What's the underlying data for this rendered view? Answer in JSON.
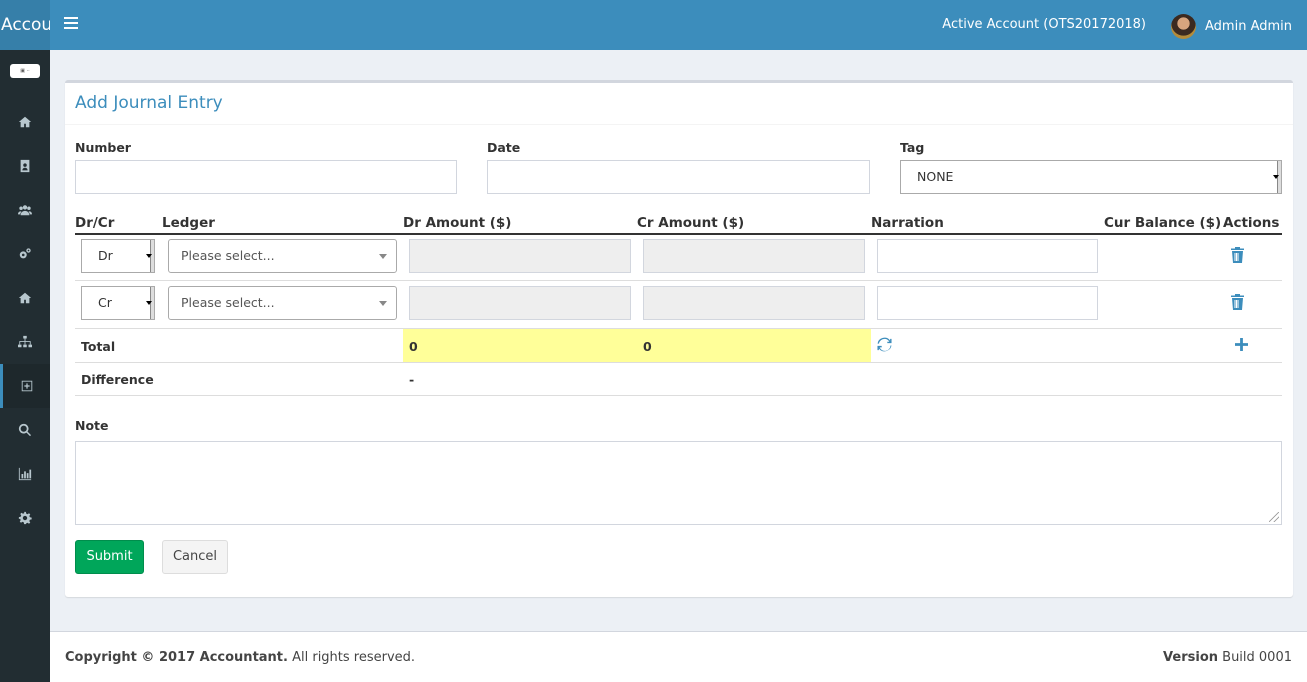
{
  "header": {
    "brand": "Accou",
    "active_account": "Active Account (OTS20172018)",
    "user_name": "Admin Admin"
  },
  "sidebar": {
    "logo_text": "logo",
    "items": [
      {
        "icon": "home-icon"
      },
      {
        "icon": "address-book-icon"
      },
      {
        "icon": "users-icon"
      },
      {
        "icon": "cogs-icon"
      },
      {
        "icon": "home-icon"
      },
      {
        "icon": "sitemap-icon"
      },
      {
        "icon": "plus-square-icon",
        "active": true
      },
      {
        "icon": "search-icon"
      },
      {
        "icon": "bar-chart-icon"
      },
      {
        "icon": "gear-icon"
      }
    ]
  },
  "form": {
    "title": "Add Journal Entry",
    "number_label": "Number",
    "number_value": "",
    "date_label": "Date",
    "date_value": "",
    "tag_label": "Tag",
    "tag_value": "NONE",
    "columns": [
      "Dr/Cr",
      "Ledger",
      "Dr Amount ($)",
      "Cr Amount ($)",
      "Narration",
      "Cur Balance ($)",
      "Actions"
    ],
    "rows": [
      {
        "type": "Dr",
        "ledger": "Please select...",
        "dr_amount": "",
        "cr_amount": "",
        "narration": ""
      },
      {
        "type": "Cr",
        "ledger": "Please select...",
        "dr_amount": "",
        "cr_amount": "",
        "narration": ""
      }
    ],
    "total_label": "Total",
    "total_dr": "0",
    "total_cr": "0",
    "difference_label": "Difference",
    "difference_value": "-",
    "note_label": "Note",
    "note_value": "",
    "submit_label": "Submit",
    "cancel_label": "Cancel"
  },
  "footer": {
    "copyright_bold": "Copyright © 2017 Accountant.",
    "copyright_rest": " All rights reserved.",
    "version_label": "Version",
    "version_value": " Build 0001"
  },
  "colors": {
    "header": "#3c8dbc",
    "brand_bg": "#367fa9",
    "sidebar": "#222d32",
    "title": "#3c8dbc",
    "total_highlight": "#ffff99",
    "submit": "#00a65a"
  }
}
